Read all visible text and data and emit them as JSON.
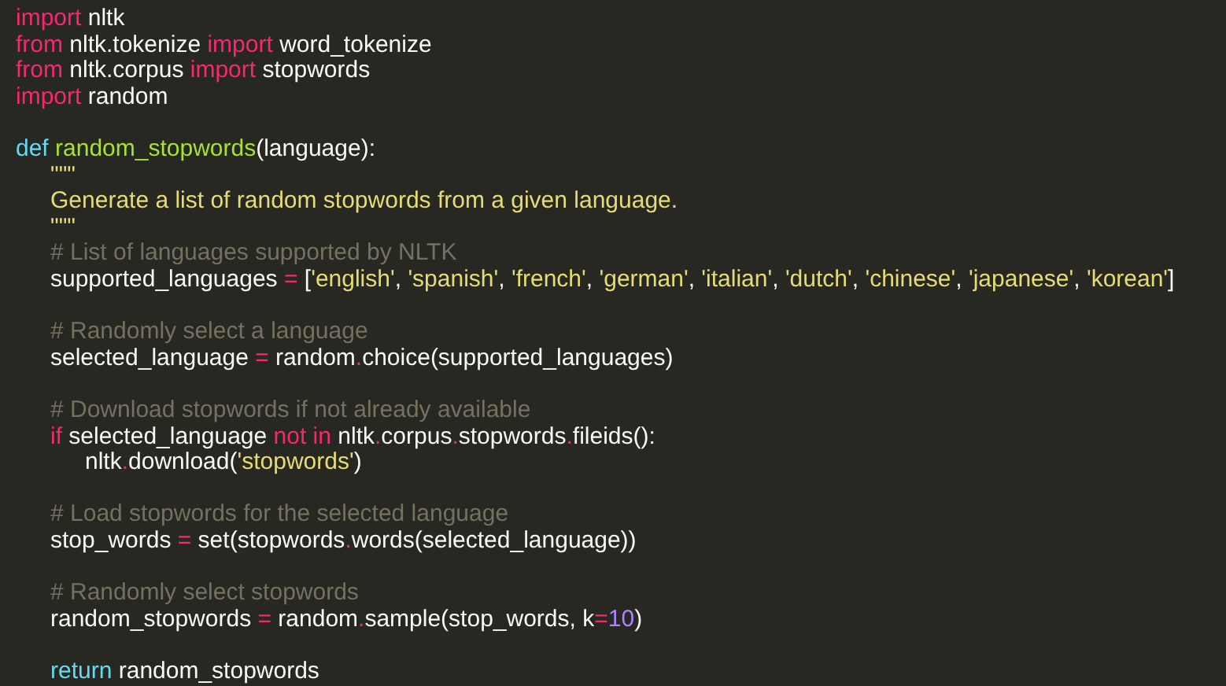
{
  "editor": {
    "lines": [
      {
        "kind": "code",
        "tokens": [
          {
            "kind": "keyword",
            "text": "import"
          },
          {
            "kind": "plain",
            "text": " nltk"
          }
        ]
      },
      {
        "kind": "code",
        "tokens": [
          {
            "kind": "keyword",
            "text": "from"
          },
          {
            "kind": "plain",
            "text": " nltk.tokenize "
          },
          {
            "kind": "keyword",
            "text": "import"
          },
          {
            "kind": "plain",
            "text": " word_tokenize"
          }
        ]
      },
      {
        "kind": "code",
        "tokens": [
          {
            "kind": "keyword",
            "text": "from"
          },
          {
            "kind": "plain",
            "text": " nltk.corpus "
          },
          {
            "kind": "keyword",
            "text": "import"
          },
          {
            "kind": "plain",
            "text": " stopwords"
          }
        ]
      },
      {
        "kind": "code",
        "tokens": [
          {
            "kind": "keyword",
            "text": "import"
          },
          {
            "kind": "plain",
            "text": " random"
          }
        ]
      },
      {
        "kind": "blank"
      },
      {
        "kind": "code",
        "tokens": [
          {
            "kind": "storage",
            "text": "def"
          },
          {
            "kind": "function",
            "text": " random_stopwords"
          },
          {
            "kind": "plain",
            "text": "(language):"
          }
        ],
        "children": [
          {
            "kind": "code",
            "tokens": [
              {
                "kind": "string",
                "text": "\"\"\""
              }
            ]
          },
          {
            "kind": "code",
            "tokens": [
              {
                "kind": "string",
                "text": "Generate a list of random stopwords from a given language."
              }
            ]
          },
          {
            "kind": "code",
            "tokens": [
              {
                "kind": "string",
                "text": "\"\"\""
              }
            ]
          },
          {
            "kind": "code",
            "tokens": [
              {
                "kind": "comment",
                "text": "# List of languages supported by NLTK"
              }
            ]
          },
          {
            "kind": "code",
            "tokens": [
              {
                "kind": "plain",
                "text": "supported_languages "
              },
              {
                "kind": "operator",
                "text": "="
              },
              {
                "kind": "plain",
                "text": " ["
              },
              {
                "kind": "string",
                "text": "'english'"
              },
              {
                "kind": "plain",
                "text": ", "
              },
              {
                "kind": "string",
                "text": "'spanish'"
              },
              {
                "kind": "plain",
                "text": ", "
              },
              {
                "kind": "string",
                "text": "'french'"
              },
              {
                "kind": "plain",
                "text": ", "
              },
              {
                "kind": "string",
                "text": "'german'"
              },
              {
                "kind": "plain",
                "text": ", "
              },
              {
                "kind": "string",
                "text": "'italian'"
              },
              {
                "kind": "plain",
                "text": ", "
              },
              {
                "kind": "string",
                "text": "'dutch'"
              },
              {
                "kind": "plain",
                "text": ", "
              },
              {
                "kind": "string",
                "text": "'chinese'"
              },
              {
                "kind": "plain",
                "text": ", "
              },
              {
                "kind": "string",
                "text": "'japanese'"
              },
              {
                "kind": "plain",
                "text": ", "
              },
              {
                "kind": "string",
                "text": "'korean'"
              },
              {
                "kind": "plain",
                "text": "]"
              }
            ]
          },
          {
            "kind": "blank"
          },
          {
            "kind": "code",
            "tokens": [
              {
                "kind": "comment",
                "text": "# Randomly select a language"
              }
            ]
          },
          {
            "kind": "code",
            "tokens": [
              {
                "kind": "plain",
                "text": "selected_language "
              },
              {
                "kind": "operator",
                "text": "="
              },
              {
                "kind": "plain",
                "text": " random"
              },
              {
                "kind": "operator",
                "text": "."
              },
              {
                "kind": "plain",
                "text": "choice(supported_languages)"
              }
            ]
          },
          {
            "kind": "blank"
          },
          {
            "kind": "code",
            "tokens": [
              {
                "kind": "comment",
                "text": "# Download stopwords if not already available"
              }
            ]
          },
          {
            "kind": "code",
            "tokens": [
              {
                "kind": "keyword",
                "text": "if"
              },
              {
                "kind": "plain",
                "text": " selected_language "
              },
              {
                "kind": "keyword",
                "text": "not in"
              },
              {
                "kind": "plain",
                "text": " nltk"
              },
              {
                "kind": "operator",
                "text": "."
              },
              {
                "kind": "plain",
                "text": "corpus"
              },
              {
                "kind": "operator",
                "text": "."
              },
              {
                "kind": "plain",
                "text": "stopwords"
              },
              {
                "kind": "operator",
                "text": "."
              },
              {
                "kind": "plain",
                "text": "fileids():"
              }
            ],
            "children": [
              {
                "kind": "code",
                "tokens": [
                  {
                    "kind": "plain",
                    "text": "nltk"
                  },
                  {
                    "kind": "operator",
                    "text": "."
                  },
                  {
                    "kind": "plain",
                    "text": "download("
                  },
                  {
                    "kind": "string",
                    "text": "'stopwords'"
                  },
                  {
                    "kind": "plain",
                    "text": ")"
                  }
                ]
              }
            ]
          },
          {
            "kind": "blank"
          },
          {
            "kind": "code",
            "tokens": [
              {
                "kind": "comment",
                "text": "# Load stopwords for the selected language"
              }
            ]
          },
          {
            "kind": "code",
            "tokens": [
              {
                "kind": "plain",
                "text": "stop_words "
              },
              {
                "kind": "operator",
                "text": "="
              },
              {
                "kind": "plain",
                "text": " set(stopwords"
              },
              {
                "kind": "operator",
                "text": "."
              },
              {
                "kind": "plain",
                "text": "words(selected_language))"
              }
            ]
          },
          {
            "kind": "blank"
          },
          {
            "kind": "code",
            "tokens": [
              {
                "kind": "comment",
                "text": "# Randomly select stopwords"
              }
            ]
          },
          {
            "kind": "code",
            "tokens": [
              {
                "kind": "plain",
                "text": "random_stopwords "
              },
              {
                "kind": "operator",
                "text": "="
              },
              {
                "kind": "plain",
                "text": " random"
              },
              {
                "kind": "operator",
                "text": "."
              },
              {
                "kind": "plain",
                "text": "sample(stop_words, k"
              },
              {
                "kind": "operator",
                "text": "="
              },
              {
                "kind": "number",
                "text": "10"
              },
              {
                "kind": "plain",
                "text": ")"
              }
            ]
          },
          {
            "kind": "blank"
          },
          {
            "kind": "code",
            "tokens": [
              {
                "kind": "storage",
                "text": "return"
              },
              {
                "kind": "plain",
                "text": " random_stopwords"
              }
            ]
          }
        ]
      }
    ]
  }
}
